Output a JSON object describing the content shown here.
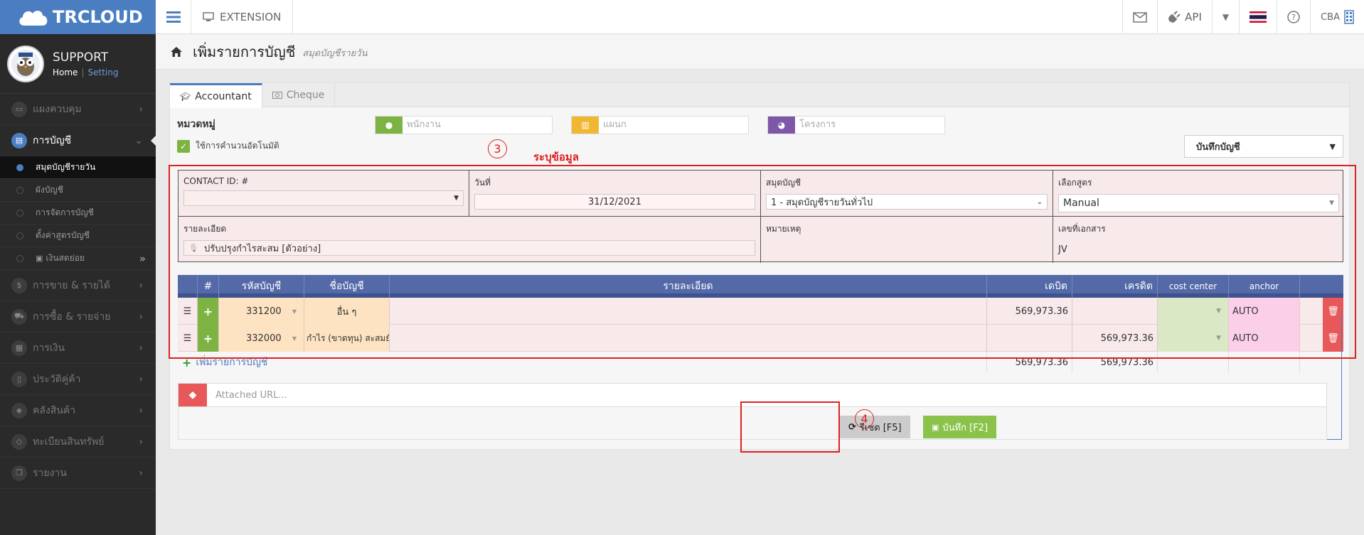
{
  "topbar": {
    "brand": "TRCLOUD",
    "extension_label": "EXTENSION",
    "api_label": "API",
    "company_label": "CBA"
  },
  "sidebar": {
    "profile": {
      "name": "SUPPORT",
      "home_link": "Home",
      "separator": "|",
      "setting_link": "Setting"
    },
    "items": [
      {
        "label": "แผงควบคุม",
        "icon": "monitor-icon"
      },
      {
        "label": "การบัญชี",
        "icon": "book-icon",
        "active": true
      },
      {
        "label": "การขาย & รายได้",
        "icon": "dollar-icon"
      },
      {
        "label": "การซื้อ & รายจ่าย",
        "icon": "cart-icon"
      },
      {
        "label": "การเงิน",
        "icon": "calendar-icon"
      },
      {
        "label": "ประวัติคู่ค้า",
        "icon": "contact-icon"
      },
      {
        "label": "คลังสินค้า",
        "icon": "cubes-icon"
      },
      {
        "label": "ทะเบียนสินทรัพย์",
        "icon": "diamond-icon"
      },
      {
        "label": "รายงาน",
        "icon": "copy-icon"
      }
    ],
    "subitems": [
      {
        "label": "สมุดบัญชีรายวัน",
        "active": true
      },
      {
        "label": "ผังบัญชี"
      },
      {
        "label": "การจัดการบัญชี"
      },
      {
        "label": "ตั้งค่าสูตรบัญชี"
      },
      {
        "label": "เงินสดย่อย"
      }
    ]
  },
  "header": {
    "title": "เพิ่มรายการบัญชี",
    "subtitle": "สมุดบัญชีรายวัน"
  },
  "tabs": [
    {
      "label": "Accountant",
      "icon": "graduation-cap-icon",
      "active": true
    },
    {
      "label": "Cheque",
      "icon": "money-icon"
    }
  ],
  "category": {
    "label": "หมวดหมู่",
    "employee_placeholder": "พนักงาน",
    "department_placeholder": "แผนก",
    "project_placeholder": "โครงการ",
    "auto_calc_label": "ใช้การคำนวนอัตโนมัติ",
    "action_select": "บันทึกบัญชี"
  },
  "annotations": {
    "step3": "3",
    "step3_label": "ระบุข้อมูล",
    "step4": "4"
  },
  "form": {
    "contact_label": "CONTACT ID: #",
    "contact_value": "",
    "date_label": "วันที่",
    "date_value": "31/12/2021",
    "journal_label": "สมุดบัญชี",
    "journal_value": "1 - สมุดบัญชีรายวันทั่วไป",
    "formula_label": "เลือกสูตร",
    "formula_value": "Manual",
    "description_label": "รายละเอียด",
    "description_value": "ปรับปรุงกำไรสะสม [ตัวอย่าง]",
    "note_label": "หมายเหตุ",
    "doc_no_label": "เลขที่เอกสาร",
    "doc_no_value": "JV"
  },
  "table": {
    "headers": {
      "num": "#",
      "account_code": "รหัสบัญชี",
      "account_name": "ชื่อบัญชี",
      "description": "รายละเอียด",
      "debit": "เดบิต",
      "credit": "เครดิต",
      "cost_center": "cost center",
      "anchor": "anchor"
    },
    "rows": [
      {
        "code": "331200",
        "name": "อื่น ๆ",
        "description": "",
        "debit": "569,973.36",
        "credit": "",
        "anchor": "AUTO"
      },
      {
        "code": "332000",
        "name": "กำไร (ขาดทุน) สะสมยังไม่",
        "description": "",
        "debit": "",
        "credit": "569,973.36",
        "anchor": "AUTO"
      }
    ],
    "add_row_label": "เพิ่มรายการบัญชี",
    "total_debit": "569,973.36",
    "total_credit": "569,973.36"
  },
  "attachment": {
    "placeholder": "Attached URL..."
  },
  "buttons": {
    "reset": "รีเซต [F5]",
    "save": "บันทึก [F2]"
  },
  "colors": {
    "brand": "#4a7ec1",
    "annotation": "#e02020",
    "table_header": "#5469a8",
    "plus_button": "#7cb342",
    "delete_button": "#e85858",
    "employee_addon": "#7cb342",
    "department_addon": "#f0b732",
    "project_addon": "#7e57a8"
  }
}
